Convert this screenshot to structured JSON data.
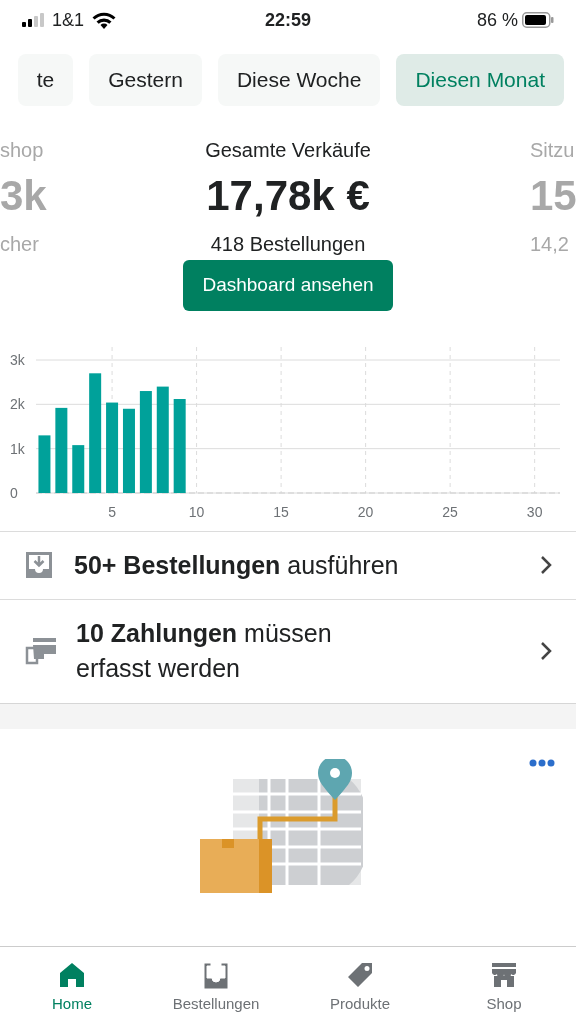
{
  "status_bar": {
    "carrier": "1&1",
    "time": "22:59",
    "battery": "86 %"
  },
  "tabs": [
    {
      "label": "te",
      "selected": false
    },
    {
      "label": "Gestern",
      "selected": false
    },
    {
      "label": "Diese Woche",
      "selected": false
    },
    {
      "label": "Diesen Monat",
      "selected": true
    }
  ],
  "stats": [
    {
      "label": "shop",
      "value": "3k",
      "sub": "cher",
      "selected": false
    },
    {
      "label": "Gesamte Verkäufe",
      "value": "17,78k €",
      "sub": "418 Bestellungen",
      "selected": true
    },
    {
      "label": "Sitzu",
      "value": "15",
      "sub": "14,2",
      "selected": false
    }
  ],
  "dashboard_button": "Dashboard ansehen",
  "chart_data": {
    "type": "bar",
    "x": [
      1,
      2,
      3,
      4,
      5,
      6,
      7,
      8,
      9
    ],
    "grid": true,
    "xlim": [
      0.5,
      31.5
    ],
    "series": [
      {
        "color": "#00a19a",
        "values": [
          1300,
          1920,
          1080,
          2700,
          2040,
          1900,
          2300,
          2400,
          2120
        ]
      }
    ],
    "ylim": [
      0,
      3000
    ],
    "yticks": [
      {
        "value": 0,
        "label": "0"
      },
      {
        "value": 1000,
        "label": "1k"
      },
      {
        "value": 2000,
        "label": "2k"
      },
      {
        "value": 3000,
        "label": "3k"
      }
    ],
    "xticks": [
      5,
      10,
      15,
      20,
      25,
      30
    ]
  },
  "tasks": [
    {
      "kind": "orders",
      "text": "**50+ Bestellungen** ausführen"
    },
    {
      "kind": "payments",
      "text": "**10 Zahlungen** müssen erfasst werden"
    }
  ],
  "nav": [
    {
      "kind": "home",
      "label": "Home",
      "selected": true
    },
    {
      "kind": "orders",
      "label": "Bestellungen",
      "selected": false
    },
    {
      "kind": "products",
      "label": "Produkte",
      "selected": false
    },
    {
      "kind": "shop",
      "label": "Shop",
      "selected": false
    }
  ]
}
